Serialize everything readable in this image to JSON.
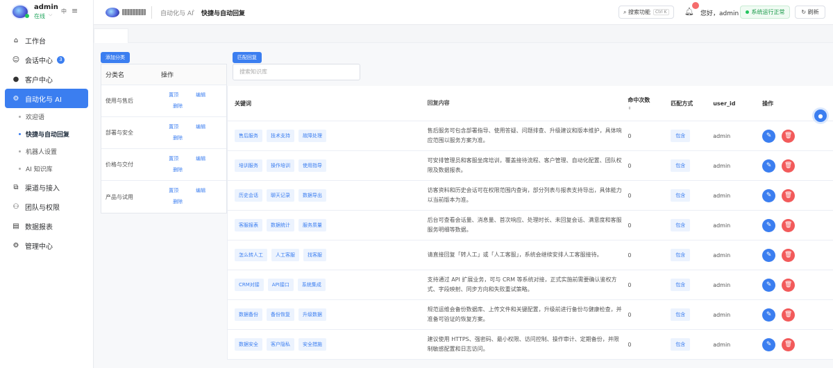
{
  "user": {
    "name": "admin",
    "status": "在线"
  },
  "sidebar": {
    "lang": "中",
    "items": [
      {
        "label": "工作台",
        "icon": "home-icon",
        "glyph": "⌂"
      },
      {
        "label": "会话中心",
        "icon": "chat-icon",
        "glyph": "☺",
        "badge": "3"
      },
      {
        "label": "客户中心",
        "icon": "user-icon",
        "glyph": "●"
      },
      {
        "label": "自动化与 AI",
        "icon": "gear-icon",
        "glyph": "⚙"
      },
      {
        "label": "渠道与接入",
        "icon": "link-icon",
        "glyph": "⧉"
      },
      {
        "label": "团队与权限",
        "icon": "team-icon",
        "glyph": "⚇"
      },
      {
        "label": "数据报表",
        "icon": "report-icon",
        "glyph": "▤"
      },
      {
        "label": "管理中心",
        "icon": "admin-icon",
        "glyph": "⚙"
      }
    ],
    "subitems": [
      "欢迎语",
      "快捷与自动回复",
      "机器人设置",
      "AI 知识库"
    ]
  },
  "topbar": {
    "crumb_parent": "自动化与 AI",
    "crumb_current": "快捷与自动回复",
    "search_label": "搜索功能",
    "search_shortcut": "Ctrl K",
    "bell_count": "",
    "greeting": "您好，admin",
    "system_status": "系统运行正常",
    "refresh": "刷新"
  },
  "left_panel": {
    "add_button": "添加分类",
    "headers": {
      "name": "分类名",
      "ops": "操作"
    },
    "rows": [
      {
        "name": "使用与售后"
      },
      {
        "name": "部署与安全"
      },
      {
        "name": "价格与交付"
      },
      {
        "name": "产品与试用"
      }
    ],
    "op_top": "置顶",
    "op_edit": "编辑",
    "op_delete": "删除"
  },
  "right_panel": {
    "match_button": "匹配回复",
    "search_placeholder": "搜索知识库",
    "headers": {
      "keyword": "关键词",
      "reply": "回复内容",
      "hits": "命中次数",
      "match": "匹配方式",
      "user": "user_id",
      "ops": "操作"
    },
    "rows": [
      {
        "keywords": [
          "售后服务",
          "技术支持",
          "故障处理"
        ],
        "reply": "售后服务可包含部署指导、使用答疑、问题排查、升级建议和版本维护，具体响应范围以服务方案为准。",
        "hits": "0",
        "match": "包含",
        "user": "admin"
      },
      {
        "keywords": [
          "培训服务",
          "操作培训",
          "使用指导"
        ],
        "reply": "可安排管理员和客服坐席培训，覆盖接待流程、客户管理、自动化配置、团队权限及数据报表。",
        "hits": "0",
        "match": "包含",
        "user": "admin"
      },
      {
        "keywords": [
          "历史会话",
          "聊天记录",
          "数据导出"
        ],
        "reply": "访客资料和历史会话可在权限范围内查询，部分列表与报表支持导出，具体能力以当前版本为准。",
        "hits": "0",
        "match": "包含",
        "user": "admin"
      },
      {
        "keywords": [
          "客服报表",
          "数据统计",
          "服务质量"
        ],
        "reply": "后台可查看会话量、消息量、首次响应、处理时长、未回复会话、满意度和客服服务明细等数据。",
        "hits": "0",
        "match": "包含",
        "user": "admin"
      },
      {
        "keywords": [
          "怎么转人工",
          "人工客服",
          "找客服"
        ],
        "reply": "请直接回复「转人工」或「人工客服」，系统会继续安排人工客服接待。",
        "hits": "0",
        "match": "包含",
        "user": "admin"
      },
      {
        "keywords": [
          "CRM对接",
          "API接口",
          "系统集成"
        ],
        "reply": "支持通过 API 扩展业务，可与 CRM 等系统对接，正式实施前需要确认鉴权方式、字段映射、同步方向和失败重试策略。",
        "hits": "0",
        "match": "包含",
        "user": "admin"
      },
      {
        "keywords": [
          "数据备份",
          "备份恢复",
          "升级数据"
        ],
        "reply": "规范运维会备份数据库、上传文件和关键配置，升级前进行备份与健康检查，并准备可验证的恢复方案。",
        "hits": "0",
        "match": "包含",
        "user": "admin"
      },
      {
        "keywords": [
          "数据安全",
          "客户隐私",
          "安全措施"
        ],
        "reply": "建议使用 HTTPS、强密码、最小权限、访问控制、操作审计、定期备份，并限制敏感配置和日志访问。",
        "hits": "0",
        "match": "包含",
        "user": "admin"
      }
    ]
  },
  "colors": {
    "primary": "#3b7ef0",
    "danger": "#f25a5a",
    "success": "#22c55e"
  }
}
